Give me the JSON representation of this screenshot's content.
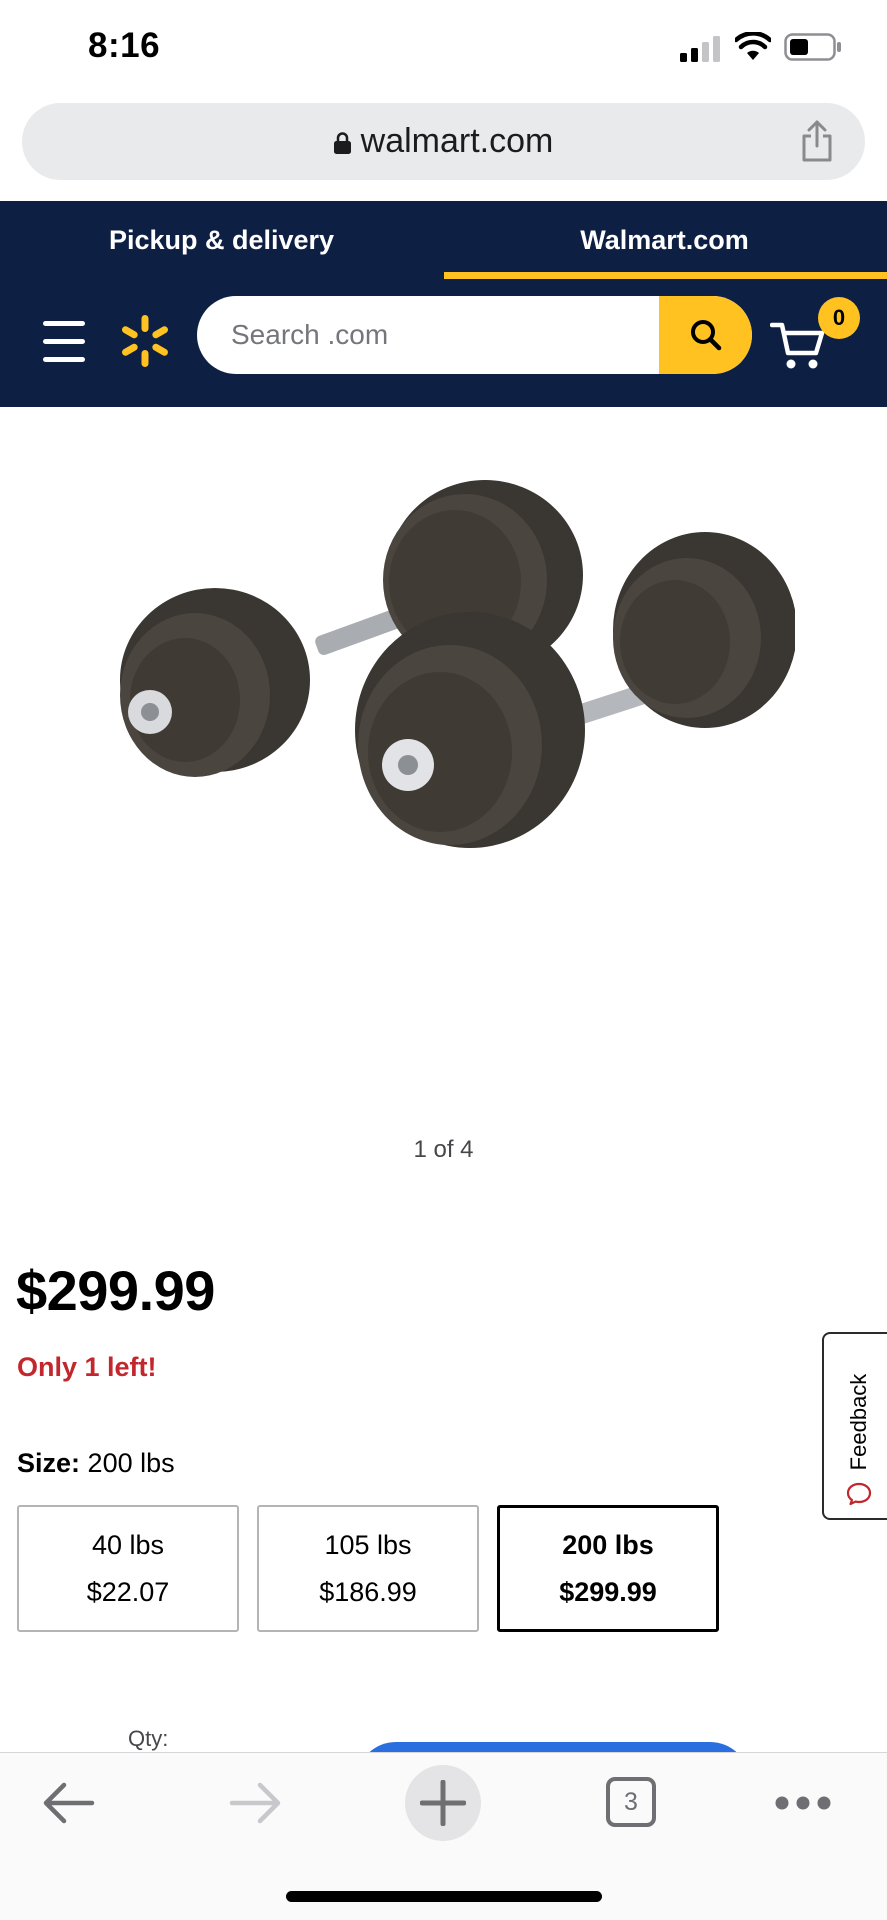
{
  "status_bar": {
    "time": "8:16"
  },
  "browser": {
    "url": "walmart.com",
    "open_tabs": "3"
  },
  "header": {
    "tabs": [
      {
        "label": "Pickup & delivery",
        "active": false
      },
      {
        "label": "Walmart.com",
        "active": true
      }
    ],
    "search_placeholder": "Search .com",
    "cart_count": "0"
  },
  "product": {
    "image_counter": "1 of 4",
    "price": "$299.99",
    "stock_message": "Only 1 left!",
    "size_label": "Size:",
    "size_value": "200 lbs",
    "size_options": [
      {
        "size": "40 lbs",
        "price": "$22.07",
        "selected": false
      },
      {
        "size": "105 lbs",
        "price": "$186.99",
        "selected": false
      },
      {
        "size": "200 lbs",
        "price": "$299.99",
        "selected": true
      }
    ],
    "qty_label": "Qty:"
  },
  "feedback": {
    "label": "Feedback"
  },
  "colors": {
    "brand_navy": "#0e1f44",
    "brand_yellow": "#ffc220",
    "stock_red": "#c1272d",
    "cta_blue": "#2a6fe0"
  },
  "icons": [
    "lock-icon",
    "share-icon",
    "menu-icon",
    "spark-logo-icon",
    "search-icon",
    "cart-icon",
    "chat-icon",
    "back-arrow-icon",
    "forward-arrow-icon",
    "plus-icon",
    "more-icon"
  ]
}
